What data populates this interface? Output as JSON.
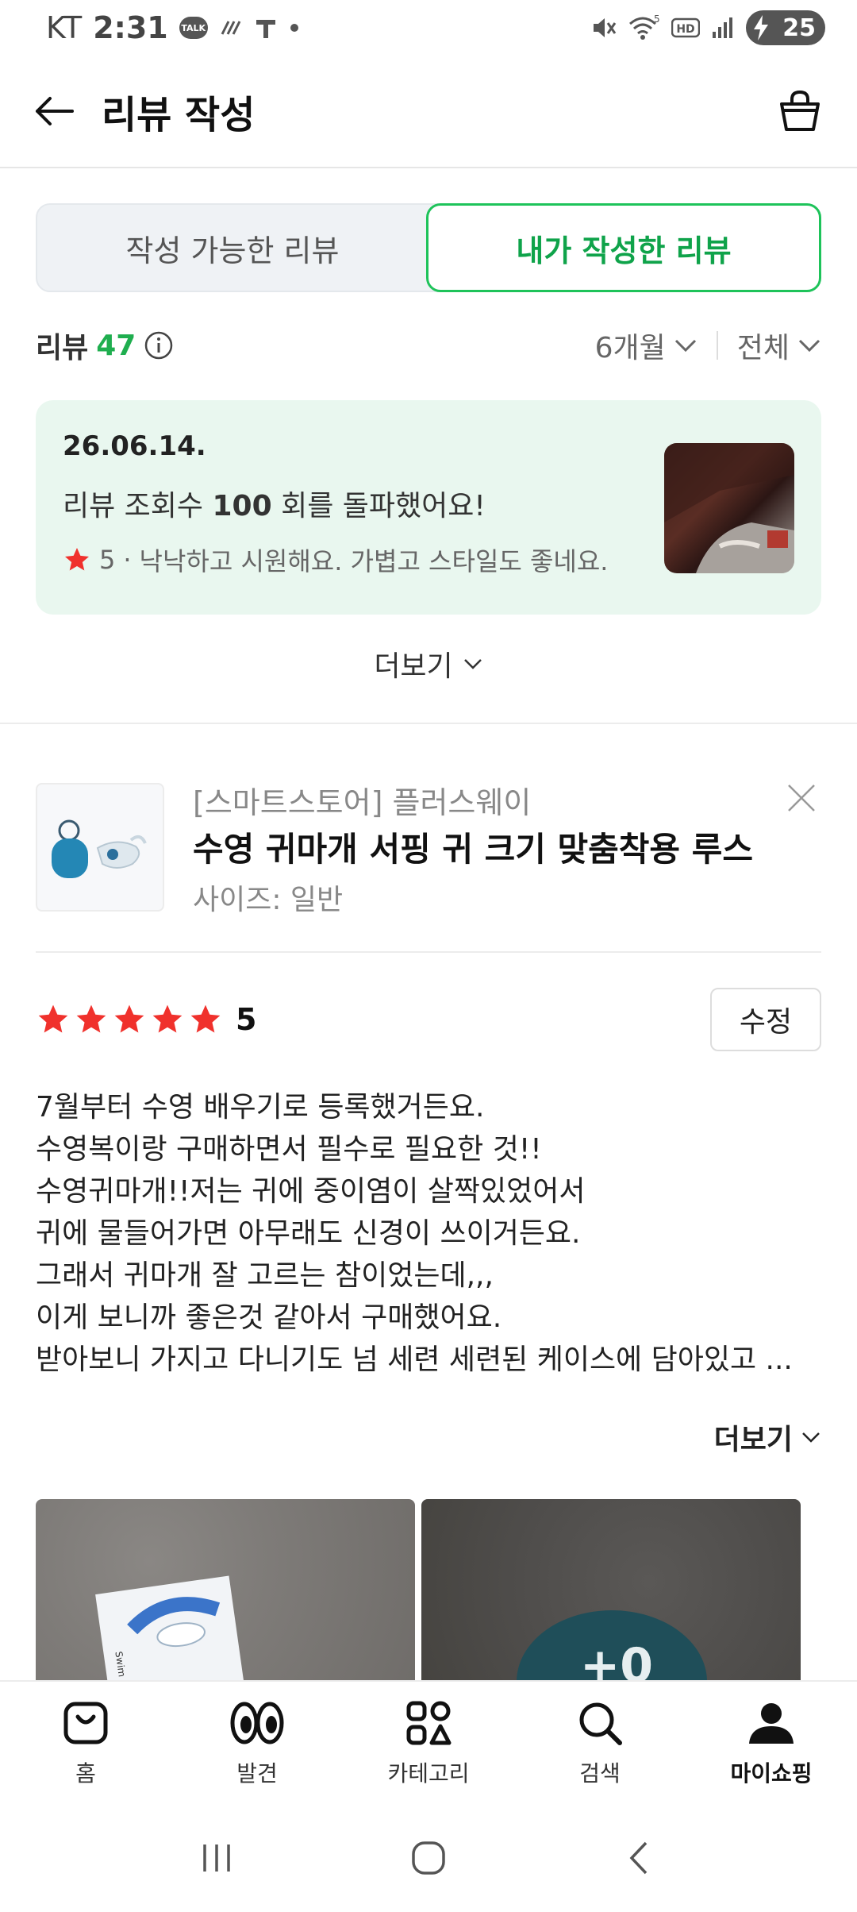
{
  "status_bar": {
    "carrier": "KT",
    "time": "2:31",
    "talk_badge": "TALK",
    "battery": "25",
    "wifi_badge": "5",
    "hd_badge": "HD"
  },
  "header": {
    "title": "리뷰 작성"
  },
  "tabs": [
    {
      "label": "작성 가능한 리뷰",
      "active": false
    },
    {
      "label": "내가 작성한 리뷰",
      "active": true
    }
  ],
  "review_count": {
    "label": "리뷰",
    "count": "47"
  },
  "filters": {
    "period": "6개월",
    "type": "전체"
  },
  "notice": {
    "date": "26.06.14.",
    "message_prefix": "리뷰 조회수 ",
    "message_bold": "100",
    "message_suffix": " 회를 돌파했어요!",
    "star": "5",
    "separator": "·",
    "snippet": "낙낙하고 시원해요. 가볍고 스타일도 좋네요."
  },
  "more_label": "더보기",
  "product": {
    "store": "[스마트스토어] 플러스웨이",
    "name": "수영 귀마개 서핑 귀 크기 맞춤착용 루스",
    "option": "사이즈: 일반"
  },
  "rating": {
    "score": 5,
    "label": "5",
    "edit_label": "수정"
  },
  "review": {
    "lines": [
      "7월부터 수영 배우기로 등록했거든요.",
      "수영복이랑 구매하면서 필수로 필요한 것!!",
      "수영귀마개!!저는 귀에 중이염이 살짝있었어서",
      "귀에 물들어가면 아무래도 신경이 쓰이거든요.",
      "그래서 귀마개 잘 고르는 참이었는데,,,",
      "이게 보니까 좋은것 같아서 구매했어요.",
      "받아보니 가지고 다니기도 넘 세련 세련된 케이스에 담아있고 ..."
    ],
    "more_label": "더보기"
  },
  "bottom_nav": [
    {
      "label": "홈",
      "icon": "home-bag-icon",
      "active": false
    },
    {
      "label": "발견",
      "icon": "eyes-icon",
      "active": false
    },
    {
      "label": "카테고리",
      "icon": "category-grid-icon",
      "active": false
    },
    {
      "label": "검색",
      "icon": "search-icon",
      "active": false
    },
    {
      "label": "마이쇼핑",
      "icon": "person-icon",
      "active": true
    }
  ],
  "colors": {
    "accent_green": "#1ec35a",
    "count_green": "#1fae4f",
    "star_red": "#f0312c",
    "notice_bg": "#e9f7ef"
  }
}
